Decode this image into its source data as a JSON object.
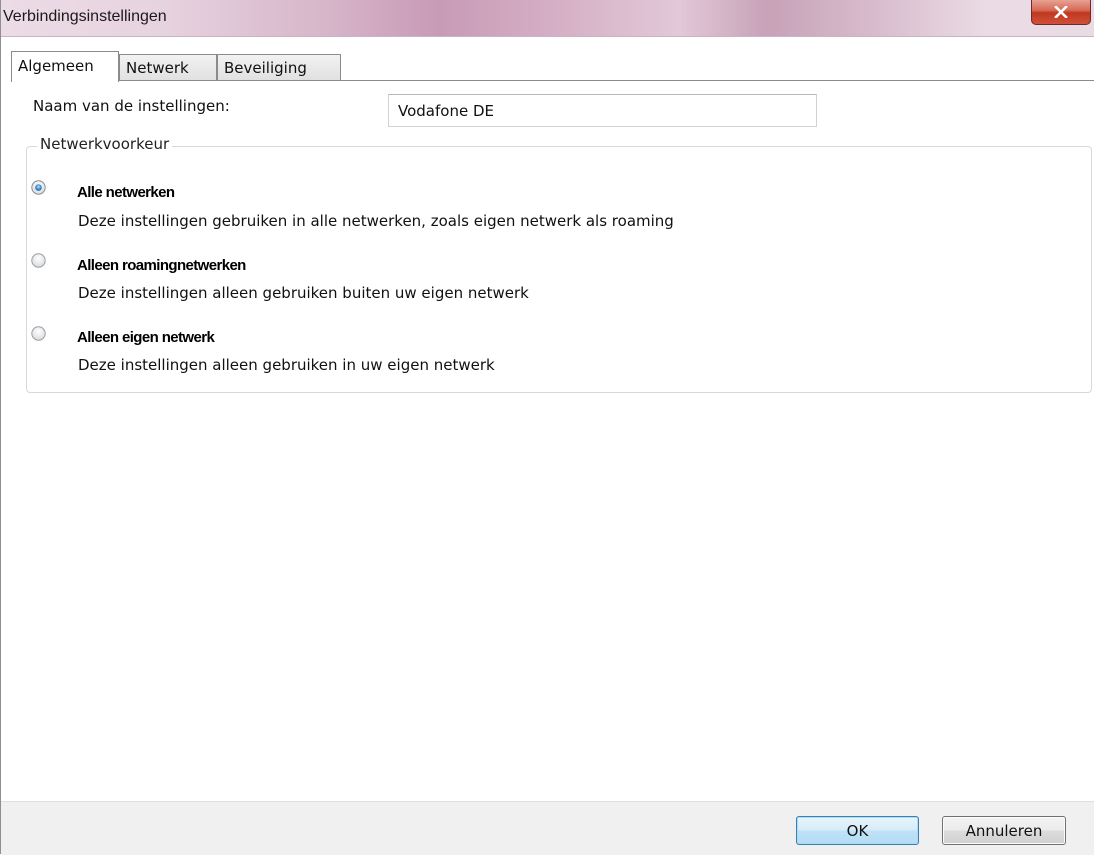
{
  "window": {
    "title": "Verbindingsinstellingen",
    "close_icon": "close-icon"
  },
  "tabs": [
    {
      "label": "Algemeen",
      "active": true
    },
    {
      "label": "Netwerk",
      "active": false
    },
    {
      "label": "Beveiliging",
      "active": false
    }
  ],
  "form": {
    "name_label": "Naam van de instellingen:",
    "name_value": "Vodafone DE"
  },
  "network_preference": {
    "legend": "Netwerkvoorkeur",
    "selected": "all",
    "options": [
      {
        "id": "all",
        "title": "Alle netwerken",
        "description": "Deze instellingen gebruiken in alle netwerken, zoals eigen netwerk als roaming",
        "checked": true
      },
      {
        "id": "roaming",
        "title": "Alleen roamingnetwerken",
        "description": "Deze instellingen alleen gebruiken buiten uw eigen netwerk",
        "checked": false
      },
      {
        "id": "home",
        "title": "Alleen eigen netwerk",
        "description": "Deze instellingen alleen gebruiken in uw eigen netwerk",
        "checked": false
      }
    ]
  },
  "footer": {
    "ok_label": "OK",
    "cancel_label": "Annuleren"
  },
  "colors": {
    "accent": "#3c7fb1",
    "close_button": "#c0391f"
  }
}
